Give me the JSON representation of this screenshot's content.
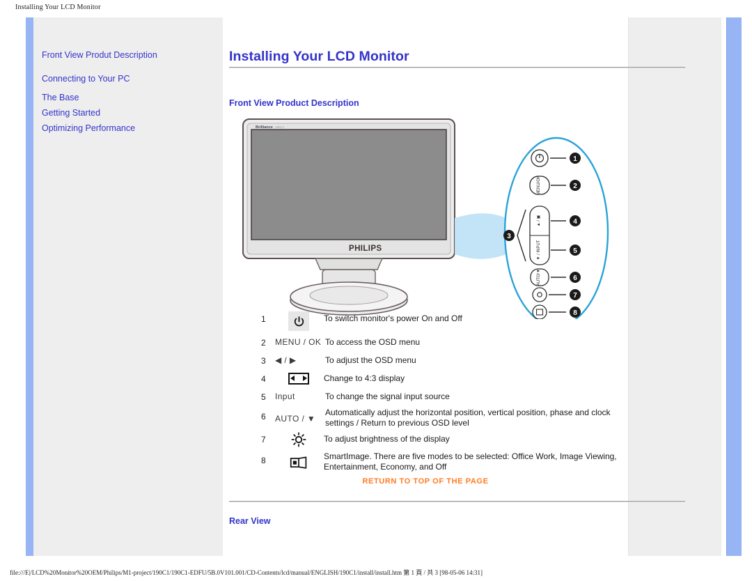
{
  "browser": {
    "print_header": "Installing Your LCD Monitor"
  },
  "sidebar": {
    "items": [
      {
        "label": "Front View Produt Description"
      },
      {
        "label": "Connecting to Your PC"
      },
      {
        "label": "The Base"
      },
      {
        "label": "Getting Started"
      },
      {
        "label": "Optimizing Performance"
      }
    ]
  },
  "main": {
    "title": "Installing Your LCD Monitor",
    "section_front": "Front View Product Description",
    "section_rear": "Rear View",
    "return_link": "RETURN TO TOP OF THE PAGE",
    "monitor": {
      "brand_small": "Brilliance",
      "brand_logo": "PHILIPS"
    },
    "callout_numbers": [
      "1",
      "2",
      "3",
      "4",
      "5",
      "6",
      "7",
      "8"
    ],
    "callout_button_labels": {
      "power": "⏻",
      "menu": "MENU/OK",
      "up": "▲ / ▣",
      "down": "▼ / INPUT",
      "auto": "AUTO/▼",
      "brightness": "☀",
      "smartimage": "❐"
    },
    "legend": [
      {
        "num": "1",
        "icon_kind": "power",
        "icon_label": "⏻",
        "desc": "To switch monitor's power On and Off"
      },
      {
        "num": "2",
        "icon_kind": "text",
        "icon_label": "MENU / OK",
        "desc": "To access the OSD menu"
      },
      {
        "num": "3",
        "icon_kind": "text",
        "icon_label": "◀ / ▶",
        "desc": "To adjust the OSD menu"
      },
      {
        "num": "4",
        "icon_kind": "ratio",
        "icon_label": "",
        "desc": "Change to 4:3 display"
      },
      {
        "num": "5",
        "icon_kind": "text",
        "icon_label": "Input",
        "desc": "To change the signal input source"
      },
      {
        "num": "6",
        "icon_kind": "text",
        "icon_label": "AUTO / ▼",
        "desc": "Automatically adjust the horizontal position, vertical position, phase and clock settings / Return to previous OSD level"
      },
      {
        "num": "7",
        "icon_kind": "brightness",
        "icon_label": "",
        "desc": "To adjust brightness of the display"
      },
      {
        "num": "8",
        "icon_kind": "smartimage",
        "icon_label": "",
        "desc": "SmartImage. There are five modes to be selected: Office Work, Image Viewing, Entertainment, Economy, and Off"
      }
    ]
  },
  "footer": {
    "path": "file:///E|/LCD%20Monitor%20OEM/Philips/M1-project/190C1/190C1-EDFU/5B.0V101.001/CD-Contents/lcd/manual/ENGLISH/190C1/install/install.htm 第 1 頁 / 共 3 [98-05-06 14:31]"
  },
  "colors": {
    "link_blue": "#3333cc",
    "frame_blue": "#97b4f5",
    "sidebar_gray": "#eeeeee",
    "accent_orange": "#ff7a21",
    "callout_blue": "#29a3d8"
  }
}
